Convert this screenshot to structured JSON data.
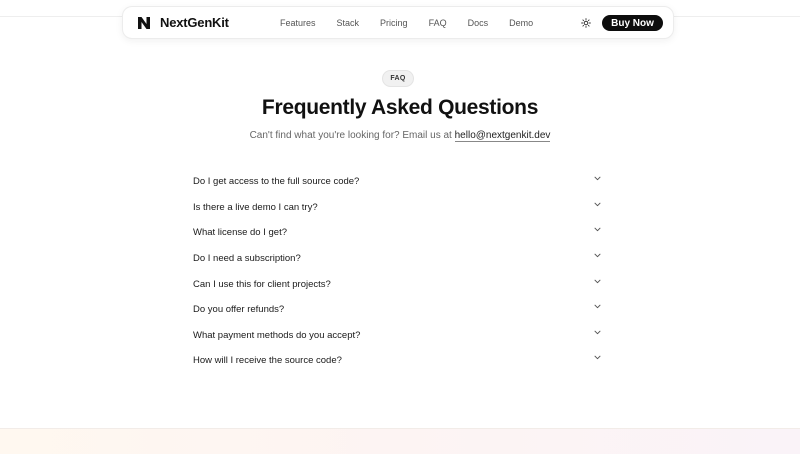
{
  "brand": {
    "name": "NextGenKit",
    "logo_icon": "n-logo-icon"
  },
  "nav": {
    "links": [
      {
        "label": "Features"
      },
      {
        "label": "Stack"
      },
      {
        "label": "Pricing"
      },
      {
        "label": "FAQ"
      },
      {
        "label": "Docs"
      },
      {
        "label": "Demo"
      }
    ],
    "theme_icon": "sun-icon",
    "buy_label": "Buy Now"
  },
  "faq": {
    "badge": "FAQ",
    "title": "Frequently Asked Questions",
    "subtitle_prefix": "Can't find what you're looking for? Email us at ",
    "email": "hello@nextgenkit.dev",
    "items": [
      {
        "question": "Do I get access to the full source code?"
      },
      {
        "question": "Is there a live demo I can try?"
      },
      {
        "question": "What license do I get?"
      },
      {
        "question": "Do I need a subscription?"
      },
      {
        "question": "Can I use this for client projects?"
      },
      {
        "question": "Do you offer refunds?"
      },
      {
        "question": "What payment methods do you accept?"
      },
      {
        "question": "How will I receive the source code?"
      }
    ]
  },
  "colors": {
    "primary": "#0d0d0d",
    "text": "#111111",
    "muted": "#666666",
    "background": "#ffffff"
  }
}
